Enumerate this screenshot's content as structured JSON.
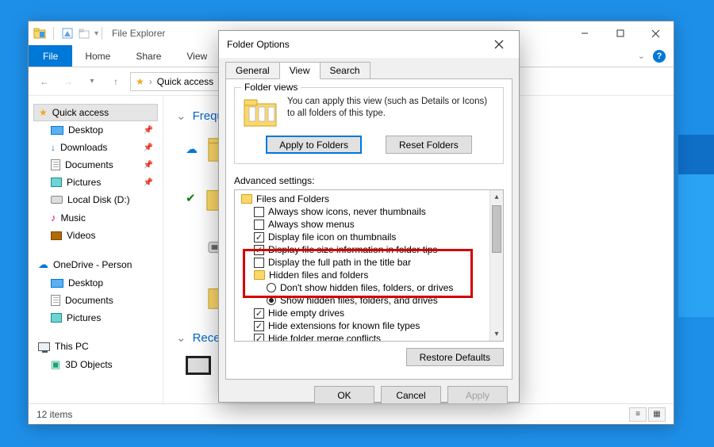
{
  "explorer": {
    "title": "File Explorer",
    "ribbon": {
      "file": "File",
      "home": "Home",
      "share": "Share",
      "view": "View"
    },
    "breadcrumb": {
      "root": "Quick access",
      "sep": "›"
    },
    "nav": {
      "quickAccess": "Quick access",
      "pinned": [
        {
          "label": "Desktop",
          "icon": "desktop-icon"
        },
        {
          "label": "Downloads",
          "icon": "down-icon"
        },
        {
          "label": "Documents",
          "icon": "doc-icon"
        },
        {
          "label": "Pictures",
          "icon": "pic-icon"
        },
        {
          "label": "Local Disk (D:)",
          "icon": "disk-icon"
        },
        {
          "label": "Music",
          "icon": "music-icon"
        },
        {
          "label": "Videos",
          "icon": "video-icon"
        }
      ],
      "oneDrive": "OneDrive - Person",
      "oneDriveItems": [
        "Desktop",
        "Documents",
        "Pictures"
      ],
      "thisPC": "This PC",
      "thisPCItems": [
        "3D Objects"
      ]
    },
    "sections": {
      "frequent": "Frequent folders",
      "recent": "Recent files"
    },
    "statusbar": "12 items"
  },
  "dialog": {
    "title": "Folder Options",
    "tabs": {
      "general": "General",
      "view": "View",
      "search": "Search"
    },
    "folderViews": {
      "legend": "Folder views",
      "text": "You can apply this view (such as Details or Icons) to all folders of this type.",
      "apply": "Apply to Folders",
      "reset": "Reset Folders"
    },
    "advancedLabel": "Advanced settings:",
    "tree": {
      "filesAndFolders": "Files and Folders",
      "items": [
        {
          "type": "check",
          "checked": false,
          "label": "Always show icons, never thumbnails"
        },
        {
          "type": "check",
          "checked": false,
          "label": "Always show menus"
        },
        {
          "type": "check",
          "checked": true,
          "label": "Display file icon on thumbnails"
        },
        {
          "type": "check",
          "checked": true,
          "label": "Display file size information in folder tips"
        },
        {
          "type": "check",
          "checked": false,
          "label": "Display the full path in the title bar"
        }
      ],
      "hiddenHeader": "Hidden files and folders",
      "hiddenOptions": [
        {
          "checked": false,
          "label": "Don't show hidden files, folders, or drives"
        },
        {
          "checked": true,
          "label": "Show hidden files, folders, and drives"
        }
      ],
      "after": [
        {
          "type": "check",
          "checked": true,
          "label": "Hide empty drives"
        },
        {
          "type": "check",
          "checked": true,
          "label": "Hide extensions for known file types"
        },
        {
          "type": "check",
          "checked": true,
          "label": "Hide folder merge conflicts"
        }
      ]
    },
    "restoreDefaults": "Restore Defaults",
    "ok": "OK",
    "cancel": "Cancel",
    "apply": "Apply"
  }
}
